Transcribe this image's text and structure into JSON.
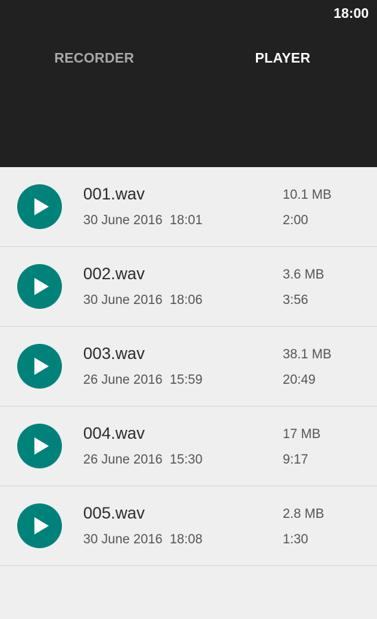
{
  "status_bar": {
    "time": "18:00"
  },
  "tabs": [
    {
      "label": "RECORDER",
      "selected": false
    },
    {
      "label": "PLAYER",
      "selected": true
    }
  ],
  "colors": {
    "header_bg": "#212121",
    "accent": "#00827b",
    "list_bg": "#efefef"
  },
  "recordings": [
    {
      "name": "001.wav",
      "date": "30 June 2016  18:01",
      "size": "10.1 MB",
      "duration": "2:00",
      "icon": "play-icon"
    },
    {
      "name": "002.wav",
      "date": "30 June 2016  18:06",
      "size": "3.6 MB",
      "duration": "3:56",
      "icon": "play-icon"
    },
    {
      "name": "003.wav",
      "date": "26 June 2016  15:59",
      "size": "38.1 MB",
      "duration": "20:49",
      "icon": "play-icon"
    },
    {
      "name": "004.wav",
      "date": "26 June 2016  15:30",
      "size": "17 MB",
      "duration": "9:17",
      "icon": "play-icon"
    },
    {
      "name": "005.wav",
      "date": "30 June 2016  18:08",
      "size": "2.8 MB",
      "duration": "1:30",
      "icon": "play-icon"
    }
  ]
}
